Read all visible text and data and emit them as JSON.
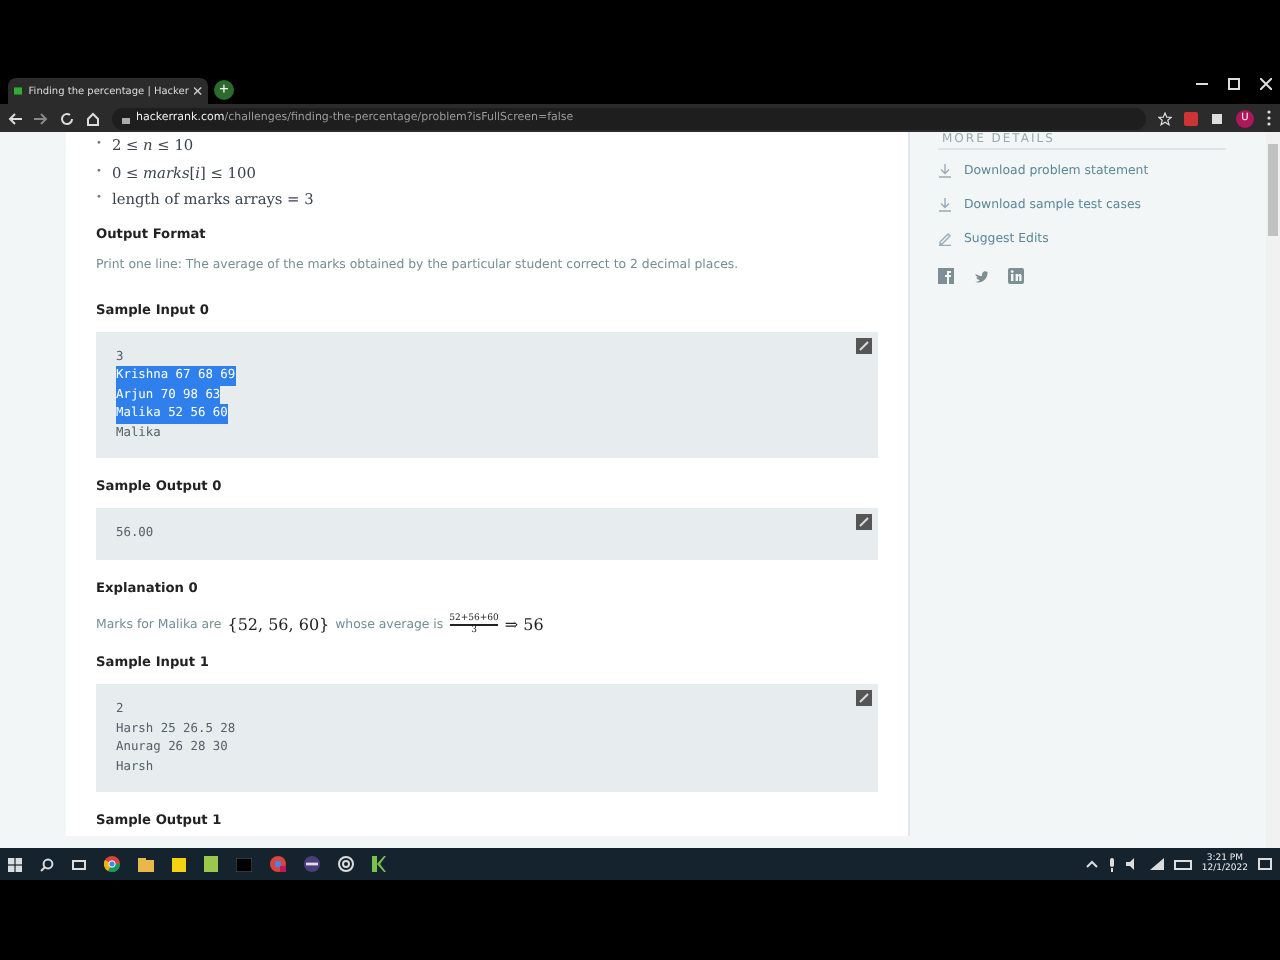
{
  "browser": {
    "tab_title": "Finding the percentage | Hacker",
    "new_tab": "+",
    "url_domain": "hackerrank.com",
    "url_path": "/challenges/finding-the-percentage/problem?isFullScreen=false",
    "profile_initial": "U"
  },
  "content": [
    {
      "kind": "bullets",
      "items": [
        {
          "marker": "•",
          "text": "2 ≤ *n* ≤ 10"
        },
        {
          "marker": "•",
          "text": "0 ≤ *marks*[*i*] ≤ 100"
        },
        {
          "marker": "•",
          "text": "length of marks arrays = 3"
        }
      ]
    },
    {
      "kind": "heading",
      "text": "Output Format"
    },
    {
      "kind": "paragraph",
      "text": "Print one line: The average of the marks obtained by the particular student correct to 2 decimal places."
    },
    {
      "kind": "heading",
      "text": "Sample Input 0"
    },
    {
      "kind": "code",
      "lines": [
        {
          "text": "3",
          "selected": false
        },
        {
          "text": "Krishna 67 68 69",
          "selected": true
        },
        {
          "text": "Arjun 70 98 63",
          "selected": true
        },
        {
          "text": "Malika 52 56 60",
          "selected": true
        },
        {
          "text": "Malika",
          "selected": false
        }
      ]
    },
    {
      "kind": "heading",
      "text": "Sample Output 0"
    },
    {
      "kind": "code",
      "lines": [
        {
          "text": "56.00",
          "selected": false
        }
      ]
    },
    {
      "kind": "heading",
      "text": "Explanation 0"
    },
    {
      "kind": "explanation",
      "lead": "Marks for Malika are",
      "set": "{52, 56, 60}",
      "middle": "whose average is",
      "numerator": "52+56+60",
      "denominator": "3",
      "result": "⇒ 56"
    },
    {
      "kind": "heading",
      "text": "Sample Input 1"
    },
    {
      "kind": "code",
      "lines": [
        {
          "text": "2",
          "selected": false
        },
        {
          "text": "Harsh 25 26.5 28",
          "selected": false
        },
        {
          "text": "Anurag 26 28 30",
          "selected": false
        },
        {
          "text": "Harsh",
          "selected": false
        }
      ]
    },
    {
      "kind": "heading",
      "text": "Sample Output 1"
    }
  ],
  "sidebar": {
    "heading": "MORE DETAILS",
    "links": [
      {
        "kind": "download",
        "label": "Download problem statement"
      },
      {
        "kind": "download",
        "label": "Download sample test cases"
      },
      {
        "kind": "edit",
        "label": "Suggest Edits"
      }
    ],
    "social": [
      {
        "kind": "facebook"
      },
      {
        "kind": "twitter"
      },
      {
        "kind": "linkedin"
      }
    ]
  },
  "taskbar": {
    "time": "3:21 PM",
    "date": "12/1/2022"
  }
}
